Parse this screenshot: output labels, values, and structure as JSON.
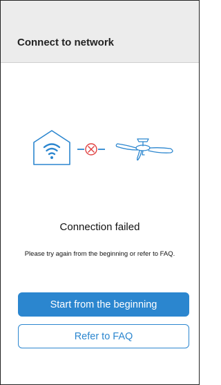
{
  "header": {
    "title": "Connect to network"
  },
  "illustration": {
    "home_icon": "home-wifi-icon",
    "error_icon": "close-circle-icon",
    "device_icon": "ceiling-fan-icon",
    "colors": {
      "primary": "#2b86cf",
      "error": "#e04040"
    }
  },
  "status": {
    "title": "Connection failed",
    "message": "Please try again from the beginning or refer to FAQ."
  },
  "actions": {
    "primary_label": "Start from the beginning",
    "secondary_label": "Refer to FAQ"
  }
}
